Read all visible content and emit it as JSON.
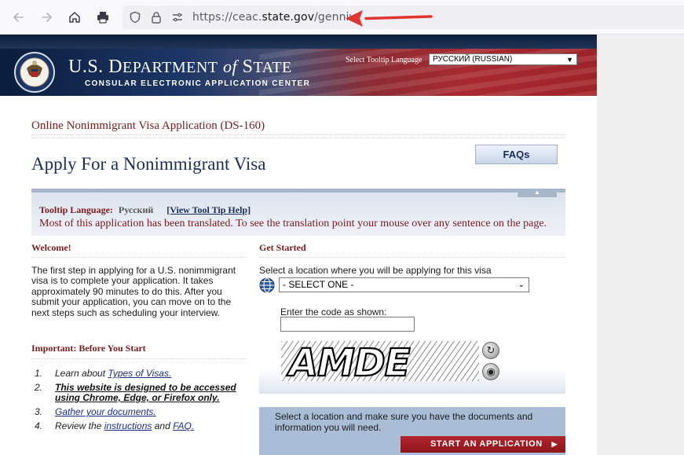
{
  "browser": {
    "url_prefix": "https://ceac.",
    "url_domain": "state.gov",
    "url_path": "/genniv/"
  },
  "header": {
    "dept_u_s": "U.S. D",
    "dept_epartment": "EPARTMENT",
    "dept_of": "of",
    "dept_s": "S",
    "dept_tate": "TATE",
    "subtitle": "CONSULAR ELECTRONIC APPLICATION CENTER",
    "tooltip_language_label": "Select Tooltip Language",
    "tooltip_language_value": "РУССКИЙ (RUSSIAN)"
  },
  "main": {
    "form_title": "Online Nonimmigrant Visa Application (DS-160)",
    "heading": "Apply For a Nonimmigrant Visa",
    "faq_button": "FAQs"
  },
  "info_box": {
    "tooltip_label": "Tooltip Language:",
    "tooltip_value": "Русский",
    "help_link": "[View Tool Tip Help]",
    "message": "Most of this application has been translated. To see the translation point your mouse over any sentence on the page."
  },
  "welcome": {
    "heading": "Welcome!",
    "text": "The first step in applying for a U.S. nonimmigrant visa is to complete your application. It takes approximately 90 minutes to do this. After you submit your application, you can move on to the next steps such as scheduling your interview."
  },
  "important": {
    "heading": "Important: Before You Start",
    "step1_num": "1.",
    "step1_prefix": "Learn about ",
    "step1_link": "Types of Visas.",
    "step2_num": "2.",
    "step2_text": "This website is designed to be accessed using Chrome, Edge, or Firefox only.",
    "step3_num": "3.",
    "step3_link": "Gather your documents.",
    "step4_num": "4.",
    "step4_prefix": "Review the ",
    "step4_link1": "instructions",
    "step4_mid": " and ",
    "step4_link2": "FAQ."
  },
  "get_started": {
    "heading": "Get Started",
    "location_prompt": "Select a location where you will be applying for this visa",
    "location_select_value": "- SELECT ONE -",
    "code_label": "Enter the code as shown:",
    "captcha_text": "AMDE",
    "start_text": "Select a location and make sure you have the documents and information you will need.",
    "start_button": "START AN APPLICATION"
  }
}
